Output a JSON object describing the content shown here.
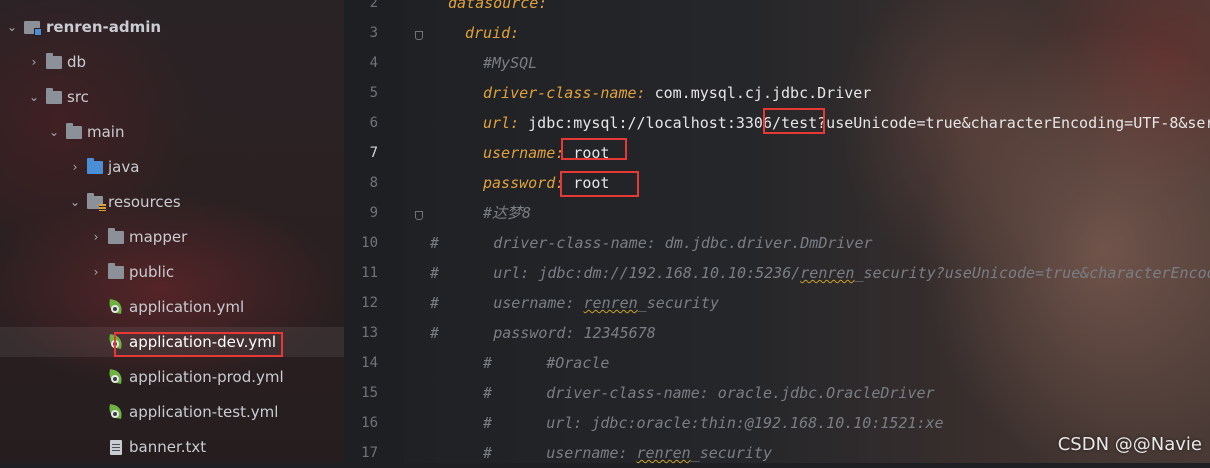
{
  "project_tree": {
    "root": "renren-admin",
    "items": [
      {
        "label": "db"
      },
      {
        "label": "src"
      },
      {
        "label": "main"
      },
      {
        "label": "java"
      },
      {
        "label": "resources"
      },
      {
        "label": "mapper"
      },
      {
        "label": "public"
      },
      {
        "label": "application.yml"
      },
      {
        "label": "application-dev.yml"
      },
      {
        "label": "application-prod.yml"
      },
      {
        "label": "application-test.yml"
      },
      {
        "label": "banner.txt"
      }
    ]
  },
  "editor": {
    "line_numbers": [
      "2",
      "3",
      "4",
      "5",
      "6",
      "7",
      "8",
      "9",
      "10",
      "11",
      "12",
      "13",
      "14",
      "15",
      "16",
      "17"
    ],
    "lines": [
      {
        "parts": [
          {
            "k": "datasource:"
          }
        ]
      },
      {
        "parts": [
          {
            "k": "druid:"
          }
        ]
      },
      {
        "parts": [
          {
            "c": "#MySQL"
          }
        ]
      },
      {
        "parts": [
          {
            "k": "driver-class-name:"
          },
          {
            "v": " com.mysql.cj.jdbc.Driver"
          }
        ]
      },
      {
        "parts": [
          {
            "k": "url:"
          },
          {
            "v": " jdbc:mysql://localhost:3306/test?useUnicode=true&characterEncoding=UTF-8&ser"
          }
        ]
      },
      {
        "parts": [
          {
            "k": "username:"
          },
          {
            "v": " root"
          }
        ]
      },
      {
        "parts": [
          {
            "k": "password:"
          },
          {
            "v": " root"
          }
        ]
      },
      {
        "parts": [
          {
            "c": "#达梦8"
          }
        ]
      },
      {
        "parts": [
          {
            "c": "#      driver-class-name: dm.jdbc.driver.DmDriver"
          }
        ]
      },
      {
        "parts": [
          {
            "c": "#      url: jdbc:dm://192.168.10.10:5236/"
          },
          {
            "cs": "renren"
          },
          {
            "c": "_security?useUnicode=true&characterEncod"
          }
        ]
      },
      {
        "parts": [
          {
            "c": "#      username: "
          },
          {
            "cs": "renren"
          },
          {
            "c": "_security"
          }
        ]
      },
      {
        "parts": [
          {
            "c": "#      password: 12345678"
          }
        ]
      },
      {
        "parts": [
          {
            "c": "#      #Oracle"
          }
        ]
      },
      {
        "parts": [
          {
            "c": "#      driver-class-name: oracle.jdbc.OracleDriver"
          }
        ]
      },
      {
        "parts": [
          {
            "c": "#      url: jdbc:oracle:thin:@192.168.10.10:1521:xe"
          }
        ]
      },
      {
        "parts": [
          {
            "c": "#      username: "
          },
          {
            "cs": "renren"
          },
          {
            "c": "_security"
          }
        ]
      }
    ]
  },
  "watermark": "CSDN @@Navie",
  "colors": {
    "highlight_box": "#e53935",
    "yaml_key": "#e0a23d",
    "comment": "#7a7e85"
  }
}
